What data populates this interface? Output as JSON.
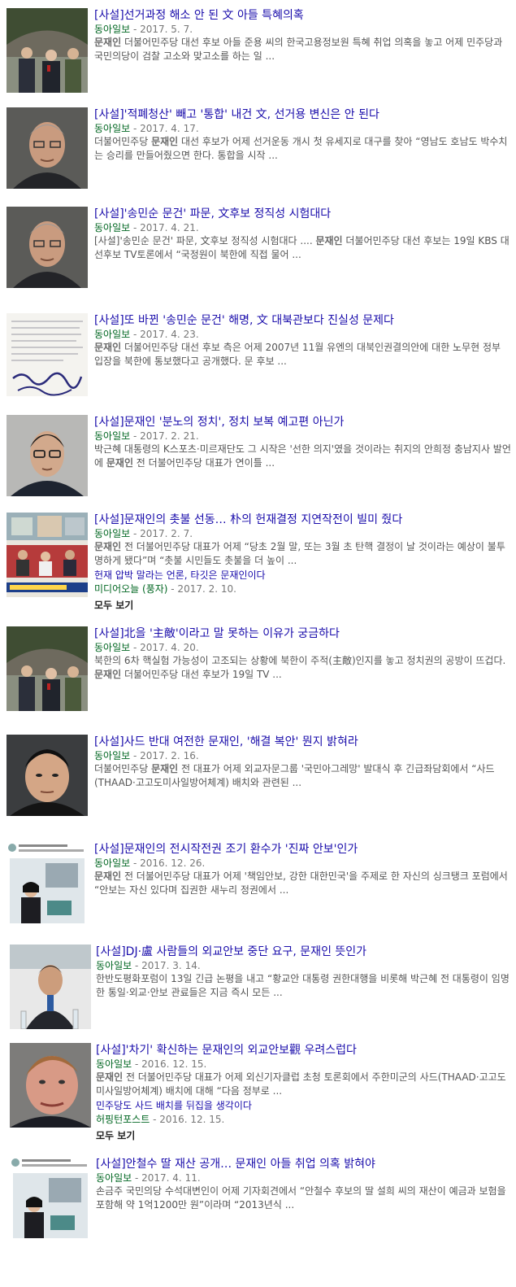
{
  "results": [
    {
      "title": "[사설]선거과정 해소 안 된 文 아들 특혜의혹",
      "source": "동아일보",
      "date": " - 2017. 5. 7.",
      "snippet": [
        {
          "t": "문재인",
          "b": true
        },
        {
          "t": " 더불어민주당 대선 후보 아들 준용 씨의 한국고용정보원 특혜 취업 의혹을 놓고 어제 민주당과 국민의당이 검찰 고소와 맞고소를 하는 일 ...",
          "b": false
        }
      ],
      "thumb": "thumb-ceremony-image"
    },
    {
      "title": "[사설]'적폐청산' 빼고 '통합' 내건 文, 선거용 변신은 안 된다",
      "source": "동아일보",
      "date": " - 2017. 4. 17.",
      "snippet": [
        {
          "t": "더불어민주당 ",
          "b": false
        },
        {
          "t": "문재인",
          "b": true
        },
        {
          "t": " 대선 후보가 어제 선거운동 개시 첫 유세지로 대구를 찾아 “영남도 호남도 박수치는 승리를 만들어줬으면 한다. 통합을 시작 ...",
          "b": false
        }
      ],
      "thumb": "thumb-columnist-portrait"
    },
    {
      "title": "[사설]'송민순 문건' 파문, 文후보 정직성 시험대다",
      "source": "동아일보",
      "date": " - 2017. 4. 21.",
      "snippet": [
        {
          "t": "[사설]'송민순 문건' 파문, 文후보 정직성 시험대다 .... ",
          "b": false
        },
        {
          "t": "문재인",
          "b": true
        },
        {
          "t": " 더불어민주당 대선 후보는 19일 KBS 대선후보 TV토론에서 “국정원이 북한에 직접 물어 ...",
          "b": false
        }
      ],
      "thumb": "thumb-columnist-portrait"
    },
    {
      "title": "[사설]또 바뀐 '송민순 문건' 해명, 文 대북관보다 진실성 문제다",
      "source": "동아일보",
      "date": " - 2017. 4. 23.",
      "snippet": [
        {
          "t": "문재인",
          "b": true
        },
        {
          "t": " 더불어민주당 대선 후보 측은 어제 2007년 11월 유엔의 대북인권결의안에 대한 노무현 정부 입장을 북한에 통보했다고 공개했다. 문 후보 ...",
          "b": false
        }
      ],
      "thumb": "thumb-handwritten-document"
    },
    {
      "title": "[사설]문재인 '분노의 정치', 정치 보복 예고편 아닌가",
      "source": "동아일보",
      "date": " - 2017. 2. 21.",
      "snippet": [
        {
          "t": "박근혜 대통령의 K스포츠·미르재단도 그 시작은 '선한 의지'였을 것이라는 취지의 안희정 충남지사 발언에 ",
          "b": false
        },
        {
          "t": "문재인",
          "b": true
        },
        {
          "t": " 전 더불어민주당 대표가 연이틀 ...",
          "b": false
        }
      ],
      "thumb": "thumb-glasses-portrait"
    },
    {
      "title": "[사설]문재인의 촛불 선동… 朴의 헌재결정 지연작전이 빌미 줬다",
      "source": "동아일보",
      "date": " - 2017. 2. 7.",
      "snippet": [
        {
          "t": "문재인",
          "b": true
        },
        {
          "t": " 전 더불어민주당 대표가 어제 “당초 2월 말, 또는 3월 초 탄핵 결정이 날 것이라는 예상이 불투명하게 됐다”며 “촛불 시민들도 촛불을 더 높이 ...",
          "b": false
        }
      ],
      "thumb": "thumb-tv-news-panel",
      "related": {
        "title": "헌재 압박 말라는 언론, 타깃은 문재인이다",
        "source": "미디어오늘 (풍자)",
        "date": " - 2017. 2. 10."
      },
      "more": "모두 보기"
    },
    {
      "title": "[사설]北을 '主敵'이라고 말 못하는 이유가 궁금하다",
      "source": "동아일보",
      "date": " - 2017. 4. 20.",
      "snippet": [
        {
          "t": "북한의 6차 핵실험 가능성이 고조되는 상황에 북한이 주적(主敵)인지를 놓고 정치권의 공방이 뜨겁다. ",
          "b": false
        },
        {
          "t": "문재인",
          "b": true
        },
        {
          "t": " 더불어민주당 대선 후보가 19일 TV ...",
          "b": false
        }
      ],
      "thumb": "thumb-ceremony-image"
    },
    {
      "title": "[사설]사드 반대 여전한 문재인, '해결 복안' 뭔지 밝혀라",
      "source": "동아일보",
      "date": " - 2017. 2. 16.",
      "snippet": [
        {
          "t": "더불어민주당 ",
          "b": false
        },
        {
          "t": "문재인",
          "b": true
        },
        {
          "t": " 전 대표가 어제 외교자문그룹 '국민아그레망' 발대식 후 긴급좌담회에서 “사드(THAAD·고고도미사일방어체계) 배치와 관련된 ...",
          "b": false
        }
      ],
      "thumb": "thumb-leader-portrait"
    },
    {
      "title": "[사설]문재인의 전시작전권 조기 환수가 '진짜 안보'인가",
      "source": "동아일보",
      "date": " - 2016. 12. 26.",
      "snippet": [
        {
          "t": "문재인",
          "b": true
        },
        {
          "t": " 전 더불어민주당 대표가 어제 '책임안보, 강한 대한민국'을 주제로 한 자신의 싱크탱크 포럼에서 “안보는 자신 있다며 집권한 새누리 정권에서 ...",
          "b": false
        }
      ],
      "thumb": "thumb-tweet-image"
    },
    {
      "title": "[사설]DJ·盧 사람들의 외교안보 중단 요구, 문재인 뜻인가",
      "source": "동아일보",
      "date": " - 2017. 3. 14.",
      "snippet": [
        {
          "t": "한반도평화포럼이 13일 긴급 논평을 내고 “황교안 대통령 권한대행을 비롯해 박근혜 전 대통령이 임명한 통일·외교·안보 관료들은 지금 즉시 모든 ...",
          "b": false
        }
      ],
      "thumb": "thumb-speaker-podium"
    },
    {
      "title": "[사설]'차기' 확신하는 문재인의 외교안보觀 우려스럽다",
      "source": "동아일보",
      "date": " - 2016. 12. 15.",
      "snippet": [
        {
          "t": "문재인",
          "b": true
        },
        {
          "t": " 전 더불어민주당 대표가 어제 외신기자클럽 초청 토론회에서 주한미군의 사드(THAAD·고고도미사일방어체계) 배치에 대해 “다음 정부로 ...",
          "b": false
        }
      ],
      "thumb": "thumb-speaker-closeup",
      "related": {
        "title": "민주당도 사드 배치를 뒤집을 생각이다",
        "source": "허핑턴포스트",
        "date": " - 2016. 12. 15."
      },
      "more": "모두 보기"
    },
    {
      "title": "[사설]안철수 딸 재산 공개… 문재인 아들 취업 의혹 밝혀야",
      "source": "동아일보",
      "date": " - 2017. 4. 11.",
      "snippet": [
        {
          "t": "손금주 국민의당 수석대변인이 어제 기자회견에서 “안철수 후보의 딸 설희 씨의 재산이 예금과 보험을 포함해 약 1억1200만 원”이라며 “2013년식 ...",
          "b": false
        }
      ],
      "thumb": "thumb-tweet-image"
    }
  ]
}
